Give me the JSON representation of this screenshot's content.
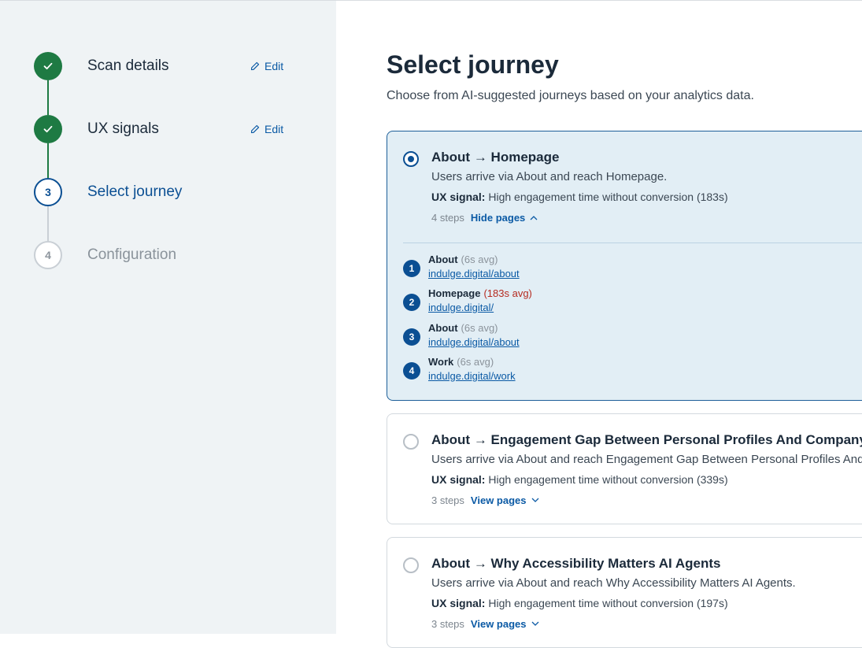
{
  "stepper": {
    "steps": [
      {
        "label": "Scan details",
        "edit_label": "Edit"
      },
      {
        "label": "UX signals",
        "edit_label": "Edit"
      },
      {
        "number": "3",
        "label": "Select journey"
      },
      {
        "number": "4",
        "label": "Configuration"
      }
    ]
  },
  "main": {
    "title": "Select journey",
    "subtitle": "Choose from AI-suggested journeys based on your analytics data."
  },
  "journeys": [
    {
      "title": "About → Homepage",
      "description": "Users arrive via About and reach Homepage.",
      "signal_label": "UX signal:",
      "signal_text": "High engagement time without conversion (183s)",
      "steps_label": "4 steps",
      "toggle_label": "Hide pages",
      "selected": true,
      "pages": [
        {
          "num": "1",
          "name": "About",
          "avg": "(6s avg)",
          "url": "indulge.digital/about"
        },
        {
          "num": "2",
          "name": "Homepage",
          "avg": "(183s avg)",
          "url": "indulge.digital/"
        },
        {
          "num": "3",
          "name": "About",
          "avg": "(6s avg)",
          "url": "indulge.digital/about"
        },
        {
          "num": "4",
          "name": "Work",
          "avg": "(6s avg)",
          "url": "indulge.digital/work"
        }
      ]
    },
    {
      "title": "About → Engagement Gap Between Personal Profiles And Company Pa",
      "description": "Users arrive via About and reach Engagement Gap Between Personal Profiles And C",
      "signal_label": "UX signal:",
      "signal_text": "High engagement time without conversion (339s)",
      "steps_label": "3 steps",
      "toggle_label": "View pages",
      "selected": false
    },
    {
      "title": "About → Why Accessibility Matters AI Agents",
      "description": "Users arrive via About and reach Why Accessibility Matters AI Agents.",
      "signal_label": "UX signal:",
      "signal_text": "High engagement time without conversion (197s)",
      "steps_label": "3 steps",
      "toggle_label": "View pages",
      "selected": false
    }
  ],
  "colors": {
    "complete": "#1e7a43",
    "primary": "#0b4f93",
    "selected_card_bg": "#e2eef5",
    "slow_page": "#b52b20"
  }
}
